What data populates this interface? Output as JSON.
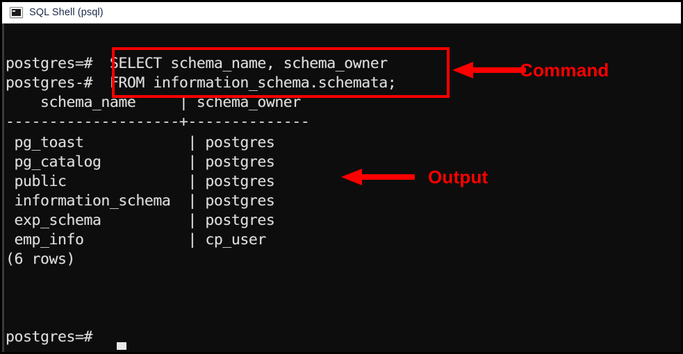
{
  "window": {
    "title": "SQL Shell (psql)",
    "icon": "console-icon",
    "frame_color": "#000000",
    "titlebar_bg": "#ffffff",
    "terminal_bg": "#0d0d0d",
    "terminal_fg": "#dcdcdc"
  },
  "terminal": {
    "lines": [
      {
        "id": "prompt-line-1",
        "text": "postgres=#  SELECT schema_name, schema_owner"
      },
      {
        "id": "prompt-line-2",
        "text": "postgres-#  FROM information_schema.schemata;"
      },
      {
        "id": "table-header",
        "text": "    schema_name     | schema_owner"
      },
      {
        "id": "table-separator",
        "text": "--------------------+--------------"
      },
      {
        "id": "row-1",
        "text": " pg_toast            | postgres"
      },
      {
        "id": "row-2",
        "text": " pg_catalog          | postgres"
      },
      {
        "id": "row-3",
        "text": " public              | postgres"
      },
      {
        "id": "row-4",
        "text": " information_schema  | postgres"
      },
      {
        "id": "row-5",
        "text": " exp_schema          | postgres"
      },
      {
        "id": "row-6",
        "text": " emp_info            | cp_user"
      },
      {
        "id": "row-count",
        "text": "(6 rows)"
      },
      {
        "id": "final-prompt",
        "text": "postgres=#"
      }
    ],
    "prompt_1": "postgres=#",
    "prompt_2": "postgres-#",
    "command_line_1": "SELECT schema_name, schema_owner",
    "command_line_2": "FROM information_schema.schemata;",
    "row_count_text": "(6 rows)",
    "final_prompt": "postgres=#",
    "cursor": "_"
  },
  "result_table": {
    "columns": [
      "schema_name",
      "schema_owner"
    ],
    "rows": [
      [
        "pg_toast",
        "postgres"
      ],
      [
        "pg_catalog",
        "postgres"
      ],
      [
        "public",
        "postgres"
      ],
      [
        "information_schema",
        "postgres"
      ],
      [
        "exp_schema",
        "postgres"
      ],
      [
        "emp_info",
        "cp_user"
      ]
    ],
    "row_count": 6
  },
  "annotations": {
    "color": "#ff0000",
    "command": {
      "label": "Command",
      "arrow": "left-arrow-icon",
      "highlight": "command-highlight-box"
    },
    "output": {
      "label": "Output",
      "arrow": "left-arrow-icon"
    }
  }
}
